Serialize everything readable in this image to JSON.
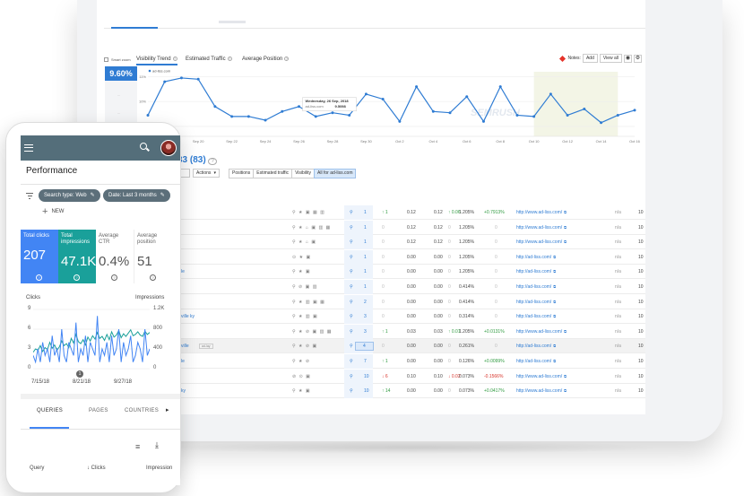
{
  "laptop": {
    "chart": {
      "show_zoom": "Smart zoom",
      "tabs": [
        "Visibility Trend",
        "Estimated Traffic",
        "Average Position"
      ],
      "notes_label": "Notes:",
      "add_label": "Add",
      "view_all_label": "View all",
      "visibility_value": "9.60%",
      "series_label": "ad-liss.com",
      "y_ticks": [
        "11%",
        "10%",
        "9%"
      ],
      "x_ticks": [
        "Sep 18",
        "Sep 20",
        "Sep 22",
        "Sep 24",
        "Sep 26",
        "Sep 28",
        "Sep 30",
        "Oct 2",
        "Oct 4",
        "Oct 6",
        "Oct 8",
        "Oct 10",
        "Oct 12",
        "Oct 14",
        "Oct 16"
      ],
      "tooltip_date": "Wednesday, 26 Sep, 2018",
      "tooltip_series": "ad-liss.com",
      "tooltip_value": "9.5098",
      "watermark": "SEMRUSH",
      "accent": "#2f7cd3"
    },
    "chart_data": {
      "type": "line",
      "x": [
        "Sep 17",
        "Sep 18",
        "Sep 19",
        "Sep 20",
        "Sep 21",
        "Sep 22",
        "Sep 23",
        "Sep 24",
        "Sep 25",
        "Sep 26",
        "Sep 27",
        "Sep 28",
        "Sep 29",
        "Sep 30",
        "Oct 1",
        "Oct 2",
        "Oct 3",
        "Oct 4",
        "Oct 5",
        "Oct 6",
        "Oct 7",
        "Oct 8",
        "Oct 9",
        "Oct 10",
        "Oct 11",
        "Oct 12",
        "Oct 13",
        "Oct 14",
        "Oct 15",
        "Oct 16"
      ],
      "series": [
        {
          "name": "ad-liss.com",
          "values": [
            9.45,
            10.8,
            10.95,
            10.9,
            9.8,
            9.4,
            9.4,
            9.25,
            9.6,
            9.8,
            9.4,
            9.55,
            9.45,
            10.3,
            10.1,
            9.2,
            10.6,
            9.6,
            9.55,
            10.2,
            9.2,
            10.6,
            9.45,
            9.4,
            10.3,
            9.45,
            9.7,
            9.15,
            9.45,
            9.65
          ]
        }
      ],
      "xlabel": "",
      "ylabel": "",
      "ylim": [
        8.6,
        11.2
      ]
    },
    "table_header": {
      "count": "33 (83)",
      "actions": "Actions",
      "filters": [
        "Positions",
        "Estimated traffic",
        "Visibility",
        "All for ad-liss.com"
      ]
    },
    "rows": [
      {
        "left": "",
        "feat": "⚲ ★ ▣ ▦ ▥",
        "pos": "1",
        "chg": "↑ 1",
        "chg_dir": "up",
        "vol": "0.12",
        "d1": "0.12",
        "d2": "↑ 0.06",
        "d2_dir": "up",
        "pct": "1.205%",
        "tr": "+0.7913%",
        "tr_dir": "up",
        "url": "http://www.ad-liss.com/"
      },
      {
        "left": "",
        "feat": "⚲ ★ ⌂ ▣ ▥ ▦",
        "pos": "1",
        "chg": "0",
        "chg_dir": "gray",
        "vol": "0.12",
        "d1": "0.12",
        "d2": "0",
        "d2_dir": "gray",
        "pct": "1.205%",
        "tr": "0",
        "tr_dir": "gray",
        "url": "http://www.ad-liss.com/"
      },
      {
        "left": "",
        "feat": "⚲ ★ ⌂ ▣",
        "pos": "1",
        "chg": "0",
        "chg_dir": "gray",
        "vol": "0.12",
        "d1": "0.12",
        "d2": "0",
        "d2_dir": "gray",
        "pct": "1.205%",
        "tr": "0",
        "tr_dir": "gray",
        "url": "http://www.ad-liss.com/"
      },
      {
        "left": "",
        "feat": "⊙ ★ ▣",
        "pos": "1",
        "chg": "0",
        "chg_dir": "gray",
        "vol": "0.00",
        "d1": "0.00",
        "d2": "0",
        "d2_dir": "gray",
        "pct": "1.205%",
        "tr": "0",
        "tr_dir": "gray",
        "url": "http://ad-liss.com/"
      },
      {
        "left": "le",
        "feat": "⚲ ★ ▣",
        "pos": "1",
        "chg": "0",
        "chg_dir": "gray",
        "vol": "0.00",
        "d1": "0.00",
        "d2": "0",
        "d2_dir": "gray",
        "pct": "1.205%",
        "tr": "0",
        "tr_dir": "gray",
        "url": "http://ad-liss.com/"
      },
      {
        "left": "",
        "feat": "⚲ ⊘ ▣ ▥",
        "pos": "1",
        "chg": "0",
        "chg_dir": "gray",
        "vol": "0.00",
        "d1": "0.00",
        "d2": "0",
        "d2_dir": "gray",
        "pct": "0.414%",
        "tr": "0",
        "tr_dir": "gray",
        "url": "http://ad-liss.com/"
      },
      {
        "left": "",
        "feat": "⚲ ★ ▥ ▣ ▦",
        "pos": "2",
        "chg": "0",
        "chg_dir": "gray",
        "vol": "0.00",
        "d1": "0.00",
        "d2": "0",
        "d2_dir": "gray",
        "pct": "0.414%",
        "tr": "0",
        "tr_dir": "gray",
        "url": "http://ad-liss.com/"
      },
      {
        "left": "ville ky",
        "feat": "⚲ ★ ▥ ▣",
        "pos": "3",
        "chg": "0",
        "chg_dir": "gray",
        "vol": "0.00",
        "d1": "0.00",
        "d2": "0",
        "d2_dir": "gray",
        "pct": "0.314%",
        "tr": "0",
        "tr_dir": "gray",
        "url": "http://ad-liss.com/"
      },
      {
        "left": "",
        "feat": "⚲ ★ ⊘ ▣ ▥ ▦",
        "pos": "3",
        "chg": "↑ 1",
        "chg_dir": "up",
        "vol": "0.03",
        "d1": "0.03",
        "d2": "↑ 0.01",
        "d2_dir": "up",
        "pct": "1.205%",
        "tr": "+0.0131%",
        "tr_dir": "up",
        "url": "http://www.ad-liss.com/"
      },
      {
        "left": "ville",
        "tag": "ad-lay",
        "feat": "⚲ ★ ⊘ ▣",
        "pos": "4",
        "chg": "0",
        "chg_dir": "gray",
        "vol": "0.00",
        "d1": "0.00",
        "d2": "0",
        "d2_dir": "gray",
        "pct": "0.261%",
        "tr": "0",
        "tr_dir": "gray",
        "url": "http://ad-liss.com/",
        "highlight": true
      },
      {
        "left": "le",
        "feat": "⚲ ★ ⊘",
        "pos": "7",
        "chg": "↑ 1",
        "chg_dir": "up",
        "vol": "0.00",
        "d1": "0.00",
        "d2": "0",
        "d2_dir": "gray",
        "pct": "0.126%",
        "tr": "+0.0099%",
        "tr_dir": "up",
        "url": "http://ad-liss.com/"
      },
      {
        "left": "",
        "feat": "⊘ ⊙ ▣",
        "pos": "10",
        "chg": "↓ 6",
        "chg_dir": "down",
        "vol": "0.10",
        "d1": "0.10",
        "d2": "↓ 0.02",
        "d2_dir": "down",
        "pct": "0.073%",
        "tr": "-0.1566%",
        "tr_dir": "down",
        "url": "http://www.ad-liss.com/"
      },
      {
        "left": "ky",
        "feat": "⚲ ★ ▣",
        "pos": "10",
        "chg": "↑ 14",
        "chg_dir": "up",
        "vol": "0.00",
        "d1": "0.00",
        "d2": "0",
        "d2_dir": "gray",
        "pct": "0.073%",
        "tr": "+0.0417%",
        "tr_dir": "up",
        "url": "http://www.ad-liss.com/"
      }
    ],
    "na_label": "n/a",
    "num_label": "10"
  },
  "phone": {
    "title": "Performance",
    "chip_search": "Search type: Web",
    "chip_date": "Date: Last 3 months",
    "new_label": "NEW",
    "metrics": [
      {
        "label": "Total clicks",
        "value": "207"
      },
      {
        "label": "Total impressions",
        "value": "47.1K"
      },
      {
        "label": "Average CTR",
        "value": "0.4%"
      },
      {
        "label": "Average position",
        "value": "51"
      }
    ],
    "clicks_label": "Clicks",
    "impressions_label": "Impressions",
    "clicks_ticks": [
      "9",
      "6",
      "3",
      "0"
    ],
    "impr_ticks": [
      "1.2K",
      "800",
      "400",
      "0"
    ],
    "x_ticks": [
      "7/15/18",
      "8/21/18",
      "9/27/18"
    ],
    "marker": "1",
    "tabs": [
      "QUERIES",
      "PAGES",
      "COUNTRIES"
    ],
    "col_query": "Query",
    "col_clicks": "Clicks",
    "col_impressions": "Impression",
    "clicks_color": "#4285f4",
    "impressions_color": "#1aa09a"
  }
}
